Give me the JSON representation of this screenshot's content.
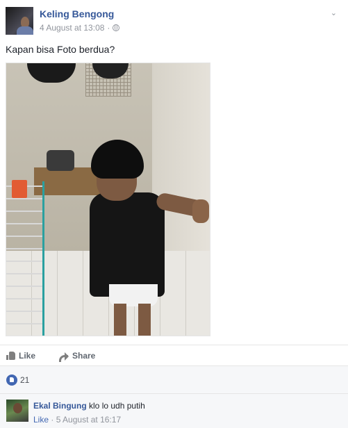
{
  "post": {
    "author": "Keling Bengong",
    "timestamp": "4 August at 13:08",
    "separator": "·",
    "privacy_icon": "globe-icon",
    "text": "Kapan bisa Foto berdua?"
  },
  "actions": {
    "like_label": "Like",
    "share_label": "Share"
  },
  "reactions": {
    "like_count": "21"
  },
  "comments": [
    {
      "author": "Ekal Bingung",
      "text": "klo lo udh putih",
      "like_label": "Like",
      "separator": "·",
      "timestamp": "5 August at 16:17"
    }
  ],
  "colors": {
    "link": "#365899",
    "accent": "#4267b2",
    "muted": "#90949c"
  }
}
